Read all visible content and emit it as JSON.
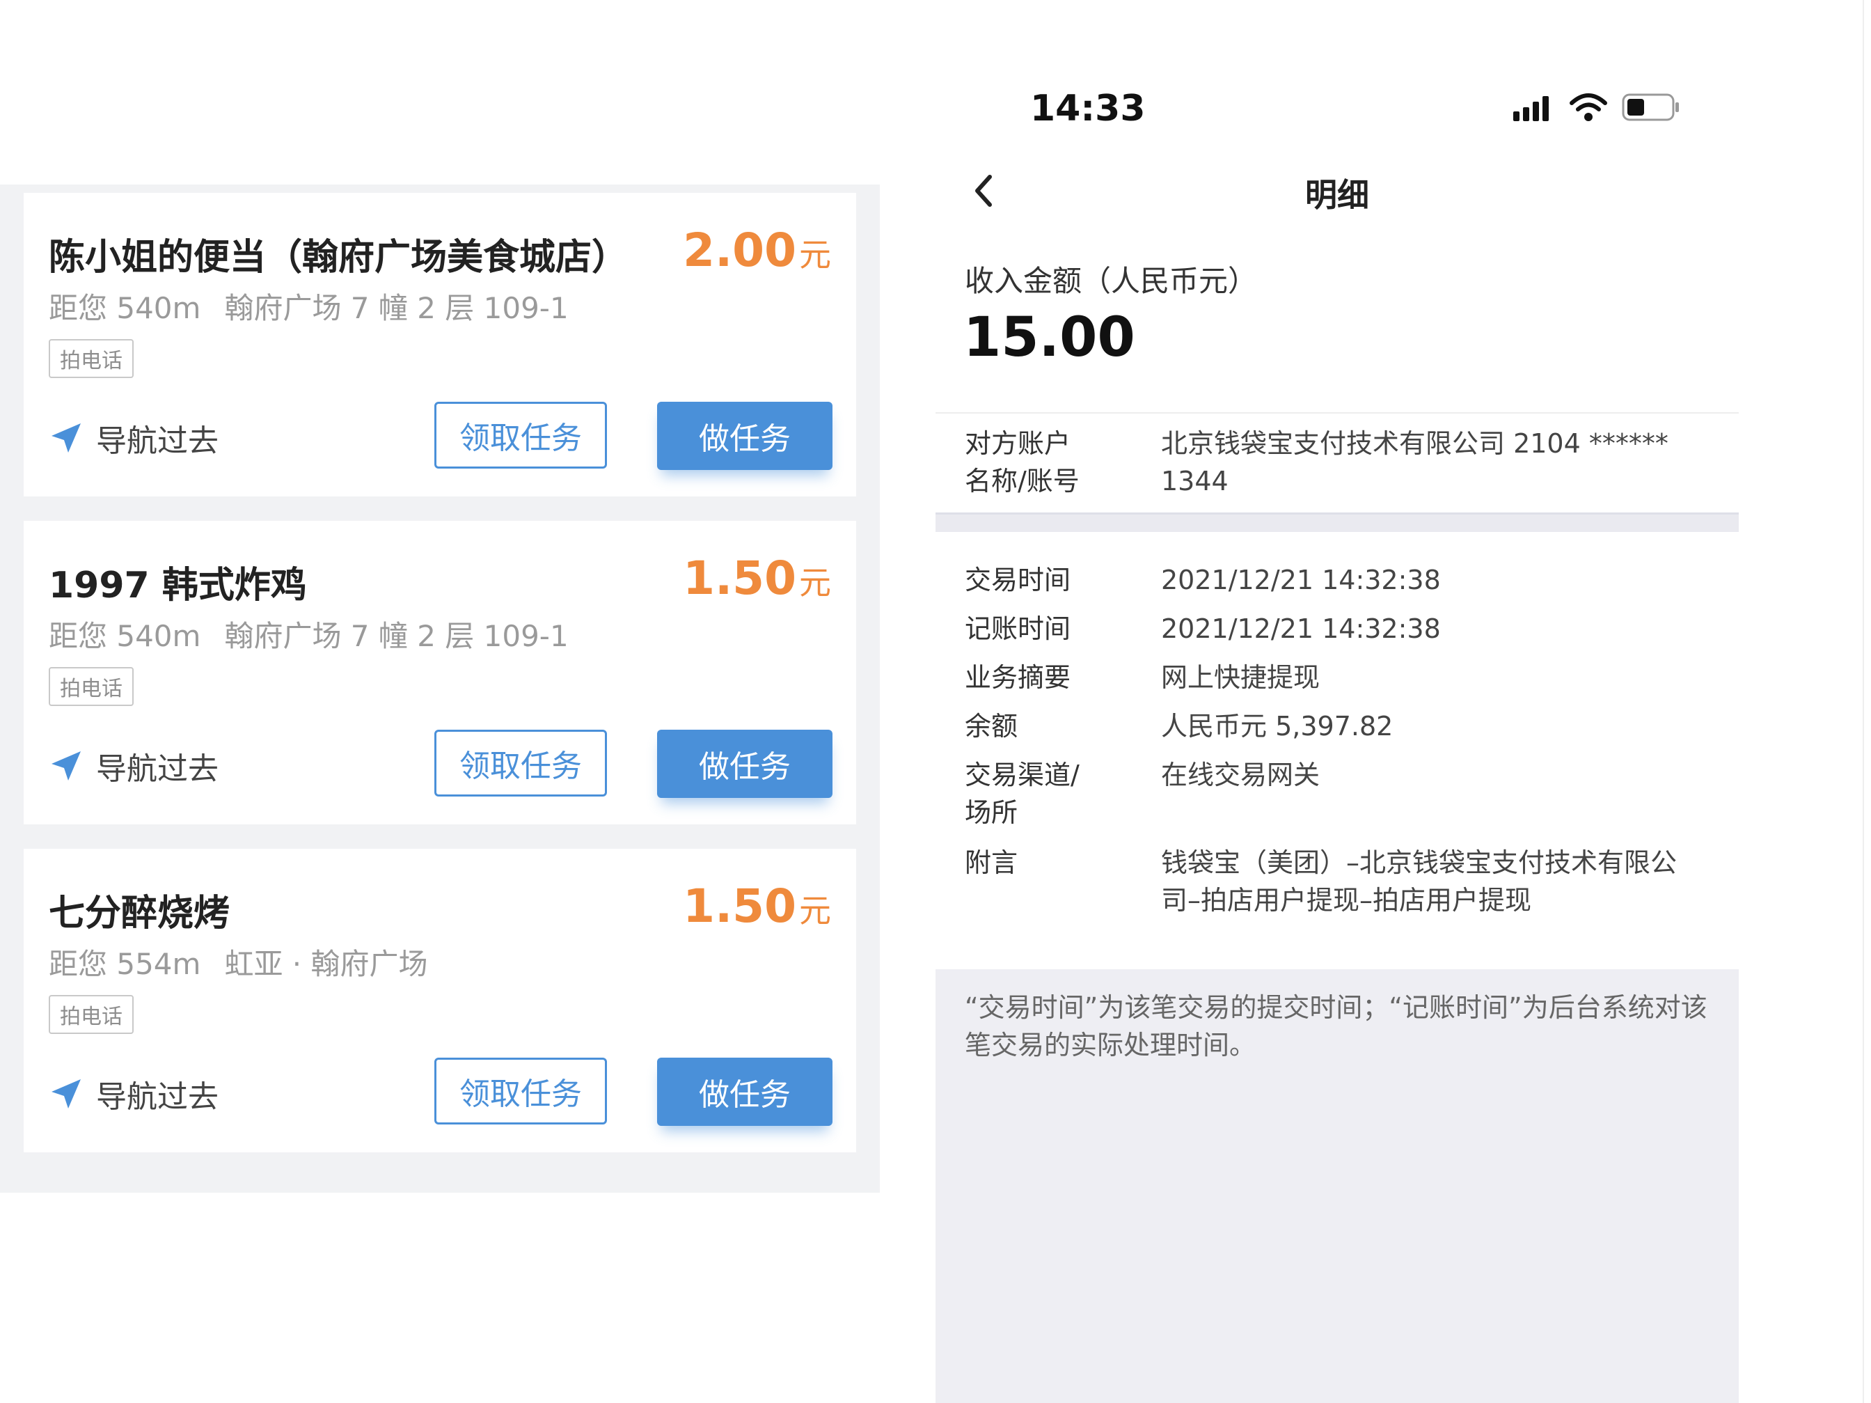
{
  "left_panel": {
    "tasks": [
      {
        "store": "陈小姐的便当（翰府广场美食城店）",
        "price": "2.00",
        "unit": "元",
        "distance": "距您 540m",
        "address": "翰府广场 7 幢 2 层 109-1",
        "tag": "拍电话",
        "nav_label": "导航过去",
        "claim_label": "领取任务",
        "do_label": "做任务"
      },
      {
        "store": "1997 韩式炸鸡",
        "price": "1.50",
        "unit": "元",
        "distance": "距您 540m",
        "address": "翰府广场 7 幢 2 层 109-1",
        "tag": "拍电话",
        "nav_label": "导航过去",
        "claim_label": "领取任务",
        "do_label": "做任务"
      },
      {
        "store": "七分醉烧烤",
        "price": "1.50",
        "unit": "元",
        "distance": "距您 554m",
        "address": "虹亚 · 翰府广场",
        "tag": "拍电话",
        "nav_label": "导航过去",
        "claim_label": "领取任务",
        "do_label": "做任务"
      }
    ]
  },
  "status_bar": {
    "time": "14:33"
  },
  "detail_page": {
    "title": "明细",
    "income_label": "收入金额（人民币元）",
    "income_amount": "15.00",
    "account": {
      "label_line1": "对方账户",
      "label_line2": "名称/账号",
      "value_line1": "北京钱袋宝支付技术有限公司 2104 ******",
      "value_line2": "1344"
    },
    "rows": [
      {
        "label": "交易时间",
        "value": "2021/12/21   14:32:38"
      },
      {
        "label": "记账时间",
        "value": "2021/12/21   14:32:38"
      },
      {
        "label": "业务摘要",
        "value": "网上快捷提现"
      },
      {
        "label": "余额",
        "value": "人民币元 5,397.82"
      }
    ],
    "channel": {
      "label_line1": "交易渠道/",
      "label_line2": "场所",
      "value": "在线交易网关"
    },
    "remark": {
      "label": "附言",
      "value_line1": "钱袋宝（美团）–北京钱袋宝支付技术有限公",
      "value_line2": "司–拍店用户提现–拍店用户提现"
    },
    "footer_note": "“交易时间”为该笔交易的提交时间；“记账时间”为后台系统对该笔交易的实际处理时间。"
  },
  "colors": {
    "accent_blue": "#4a90d9",
    "price_orange": "#ef8a3c"
  },
  "icons": {
    "nav": "navigation-arrow-icon",
    "back": "chevron-left-icon",
    "signal": "signal-bars-icon",
    "wifi": "wifi-icon",
    "battery": "battery-icon"
  }
}
